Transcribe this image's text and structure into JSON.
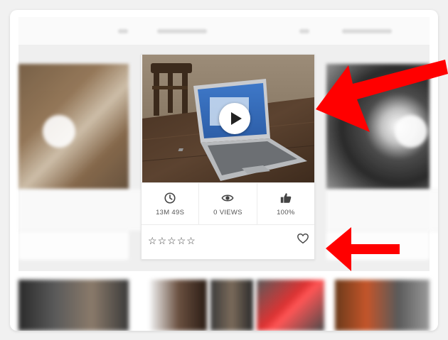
{
  "video_card": {
    "stats": {
      "duration": "13M 49S",
      "views": "0 VIEWS",
      "rating": "100%"
    },
    "stars_count": 5,
    "star_glyph": "☆"
  },
  "icons": {
    "duration": "clock-icon",
    "views": "eye-icon",
    "rating": "thumbs-up-icon",
    "favorite": "heart-icon",
    "play": "play-icon"
  },
  "colors": {
    "arrow": "#ff0000",
    "text": "#555555",
    "border": "#ececec"
  }
}
